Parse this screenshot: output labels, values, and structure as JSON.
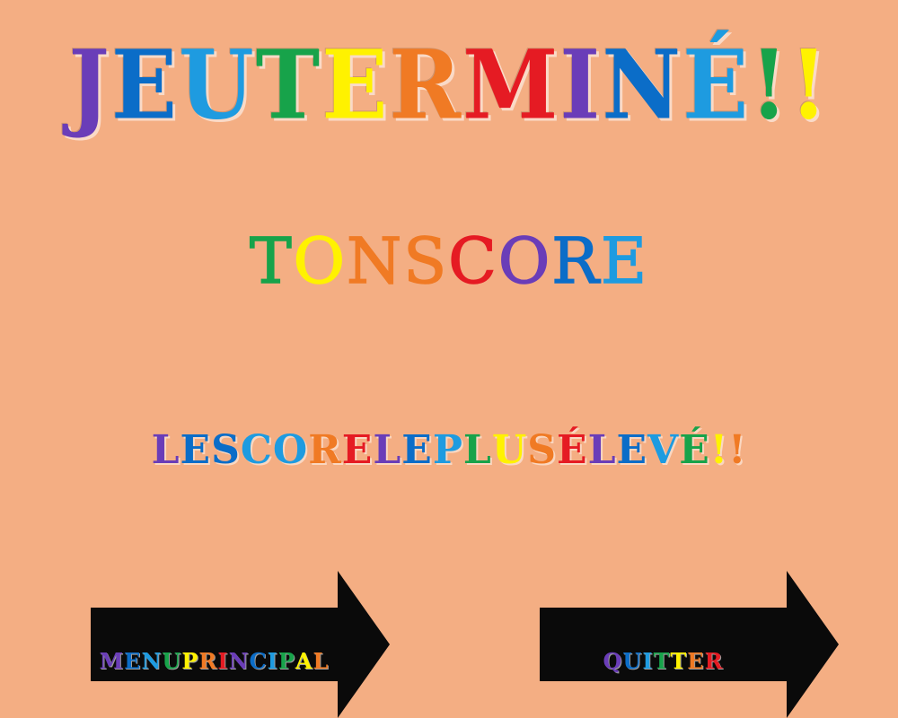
{
  "screen": {
    "title": "JEU TERMINÉ!!",
    "score_label": "TON SCORE",
    "highscore_label": "LE SCORE LE PLUS ÉLEVÉ!!"
  },
  "buttons": {
    "menu_label": "MENU PRINCIPAL",
    "quit_label": "QUITTER"
  },
  "colors": {
    "background": "#F4AE83",
    "button_fill": "#0A0A0A",
    "rainbow": [
      "#6A3DB8",
      "#0B6DC8",
      "#1E9BE0",
      "#17A34A",
      "#FFF200",
      "#F07A24",
      "#E51B23"
    ]
  }
}
